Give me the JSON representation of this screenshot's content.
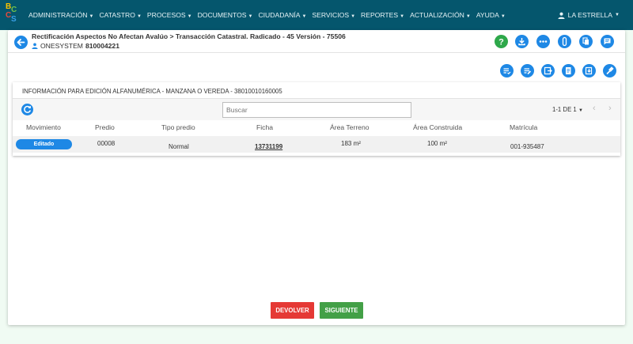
{
  "nav": {
    "menu": [
      "ADMINISTRACIÓN",
      "CATASTRO",
      "PROCESOS",
      "DOCUMENTOS",
      "CIUDADANÍA",
      "SERVICIOS",
      "REPORTES",
      "ACTUALIZACIÓN",
      "AYUDA"
    ],
    "user": "LA ESTRELLA",
    "logo": {
      "b": "B",
      "c1": "C",
      "c2": "C",
      "s": "S"
    }
  },
  "header": {
    "title": "Rectificación Aspectos No Afectan Avalúo > Transacción Catastral. Radicado - 45 Versión - 75506",
    "user_name": "ONESYSTEM",
    "user_id": "810004221"
  },
  "panel": {
    "title": "INFORMACIÓN PARA EDICIÓN ALFANUMÉRICA - MANZANA O VEREDA - 38010010160005",
    "search_placeholder": "Buscar",
    "pager": "1-1 DE 1"
  },
  "table": {
    "headers": [
      "Movimiento",
      "Predio",
      "Tipo predio",
      "Ficha",
      "Área Terreno",
      "Área Construida",
      "Matrícula"
    ],
    "rows": [
      {
        "movimiento": "Editado",
        "predio": "00008",
        "tipo": "Normal",
        "ficha": "13731199",
        "area_terreno": "183 m²",
        "area_construida": "100 m²",
        "matricula": "001-935487"
      }
    ]
  },
  "actions": {
    "devolver": "DEVOLVER",
    "siguiente": "SIGUIENTE"
  },
  "colors": {
    "primary": "#1e88e5",
    "topbar": "#05566d",
    "danger": "#e53935",
    "success": "#43a047",
    "help": "#2ea84a"
  },
  "icons": {
    "top": [
      "help-icon",
      "download-icon",
      "more-icon",
      "attach-icon",
      "copy-icon",
      "comment-icon"
    ],
    "second": [
      "list-check-icon",
      "list-edit-icon",
      "export-icon",
      "document-icon",
      "import-icon",
      "gavel-icon"
    ]
  }
}
